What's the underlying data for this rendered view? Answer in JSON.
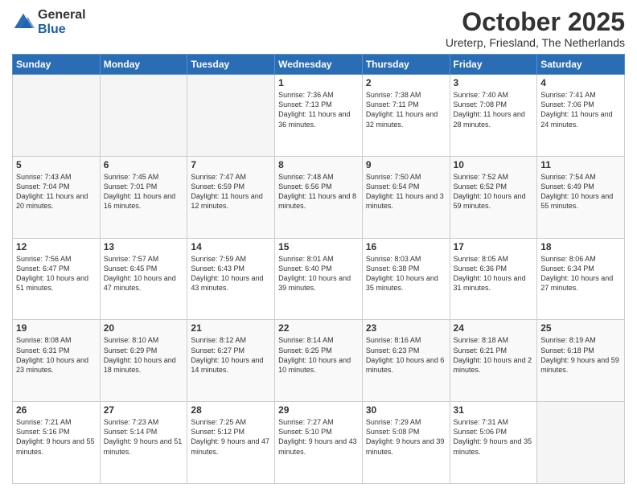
{
  "header": {
    "logo_general": "General",
    "logo_blue": "Blue",
    "month_title": "October 2025",
    "subtitle": "Ureterp, Friesland, The Netherlands"
  },
  "days_of_week": [
    "Sunday",
    "Monday",
    "Tuesday",
    "Wednesday",
    "Thursday",
    "Friday",
    "Saturday"
  ],
  "weeks": [
    [
      {
        "day": "",
        "info": ""
      },
      {
        "day": "",
        "info": ""
      },
      {
        "day": "",
        "info": ""
      },
      {
        "day": "1",
        "info": "Sunrise: 7:36 AM\nSunset: 7:13 PM\nDaylight: 11 hours\nand 36 minutes."
      },
      {
        "day": "2",
        "info": "Sunrise: 7:38 AM\nSunset: 7:11 PM\nDaylight: 11 hours\nand 32 minutes."
      },
      {
        "day": "3",
        "info": "Sunrise: 7:40 AM\nSunset: 7:08 PM\nDaylight: 11 hours\nand 28 minutes."
      },
      {
        "day": "4",
        "info": "Sunrise: 7:41 AM\nSunset: 7:06 PM\nDaylight: 11 hours\nand 24 minutes."
      }
    ],
    [
      {
        "day": "5",
        "info": "Sunrise: 7:43 AM\nSunset: 7:04 PM\nDaylight: 11 hours\nand 20 minutes."
      },
      {
        "day": "6",
        "info": "Sunrise: 7:45 AM\nSunset: 7:01 PM\nDaylight: 11 hours\nand 16 minutes."
      },
      {
        "day": "7",
        "info": "Sunrise: 7:47 AM\nSunset: 6:59 PM\nDaylight: 11 hours\nand 12 minutes."
      },
      {
        "day": "8",
        "info": "Sunrise: 7:48 AM\nSunset: 6:56 PM\nDaylight: 11 hours\nand 8 minutes."
      },
      {
        "day": "9",
        "info": "Sunrise: 7:50 AM\nSunset: 6:54 PM\nDaylight: 11 hours\nand 3 minutes."
      },
      {
        "day": "10",
        "info": "Sunrise: 7:52 AM\nSunset: 6:52 PM\nDaylight: 10 hours\nand 59 minutes."
      },
      {
        "day": "11",
        "info": "Sunrise: 7:54 AM\nSunset: 6:49 PM\nDaylight: 10 hours\nand 55 minutes."
      }
    ],
    [
      {
        "day": "12",
        "info": "Sunrise: 7:56 AM\nSunset: 6:47 PM\nDaylight: 10 hours\nand 51 minutes."
      },
      {
        "day": "13",
        "info": "Sunrise: 7:57 AM\nSunset: 6:45 PM\nDaylight: 10 hours\nand 47 minutes."
      },
      {
        "day": "14",
        "info": "Sunrise: 7:59 AM\nSunset: 6:43 PM\nDaylight: 10 hours\nand 43 minutes."
      },
      {
        "day": "15",
        "info": "Sunrise: 8:01 AM\nSunset: 6:40 PM\nDaylight: 10 hours\nand 39 minutes."
      },
      {
        "day": "16",
        "info": "Sunrise: 8:03 AM\nSunset: 6:38 PM\nDaylight: 10 hours\nand 35 minutes."
      },
      {
        "day": "17",
        "info": "Sunrise: 8:05 AM\nSunset: 6:36 PM\nDaylight: 10 hours\nand 31 minutes."
      },
      {
        "day": "18",
        "info": "Sunrise: 8:06 AM\nSunset: 6:34 PM\nDaylight: 10 hours\nand 27 minutes."
      }
    ],
    [
      {
        "day": "19",
        "info": "Sunrise: 8:08 AM\nSunset: 6:31 PM\nDaylight: 10 hours\nand 23 minutes."
      },
      {
        "day": "20",
        "info": "Sunrise: 8:10 AM\nSunset: 6:29 PM\nDaylight: 10 hours\nand 18 minutes."
      },
      {
        "day": "21",
        "info": "Sunrise: 8:12 AM\nSunset: 6:27 PM\nDaylight: 10 hours\nand 14 minutes."
      },
      {
        "day": "22",
        "info": "Sunrise: 8:14 AM\nSunset: 6:25 PM\nDaylight: 10 hours\nand 10 minutes."
      },
      {
        "day": "23",
        "info": "Sunrise: 8:16 AM\nSunset: 6:23 PM\nDaylight: 10 hours\nand 6 minutes."
      },
      {
        "day": "24",
        "info": "Sunrise: 8:18 AM\nSunset: 6:21 PM\nDaylight: 10 hours\nand 2 minutes."
      },
      {
        "day": "25",
        "info": "Sunrise: 8:19 AM\nSunset: 6:18 PM\nDaylight: 9 hours\nand 59 minutes."
      }
    ],
    [
      {
        "day": "26",
        "info": "Sunrise: 7:21 AM\nSunset: 5:16 PM\nDaylight: 9 hours\nand 55 minutes."
      },
      {
        "day": "27",
        "info": "Sunrise: 7:23 AM\nSunset: 5:14 PM\nDaylight: 9 hours\nand 51 minutes."
      },
      {
        "day": "28",
        "info": "Sunrise: 7:25 AM\nSunset: 5:12 PM\nDaylight: 9 hours\nand 47 minutes."
      },
      {
        "day": "29",
        "info": "Sunrise: 7:27 AM\nSunset: 5:10 PM\nDaylight: 9 hours\nand 43 minutes."
      },
      {
        "day": "30",
        "info": "Sunrise: 7:29 AM\nSunset: 5:08 PM\nDaylight: 9 hours\nand 39 minutes."
      },
      {
        "day": "31",
        "info": "Sunrise: 7:31 AM\nSunset: 5:06 PM\nDaylight: 9 hours\nand 35 minutes."
      },
      {
        "day": "",
        "info": ""
      }
    ]
  ]
}
